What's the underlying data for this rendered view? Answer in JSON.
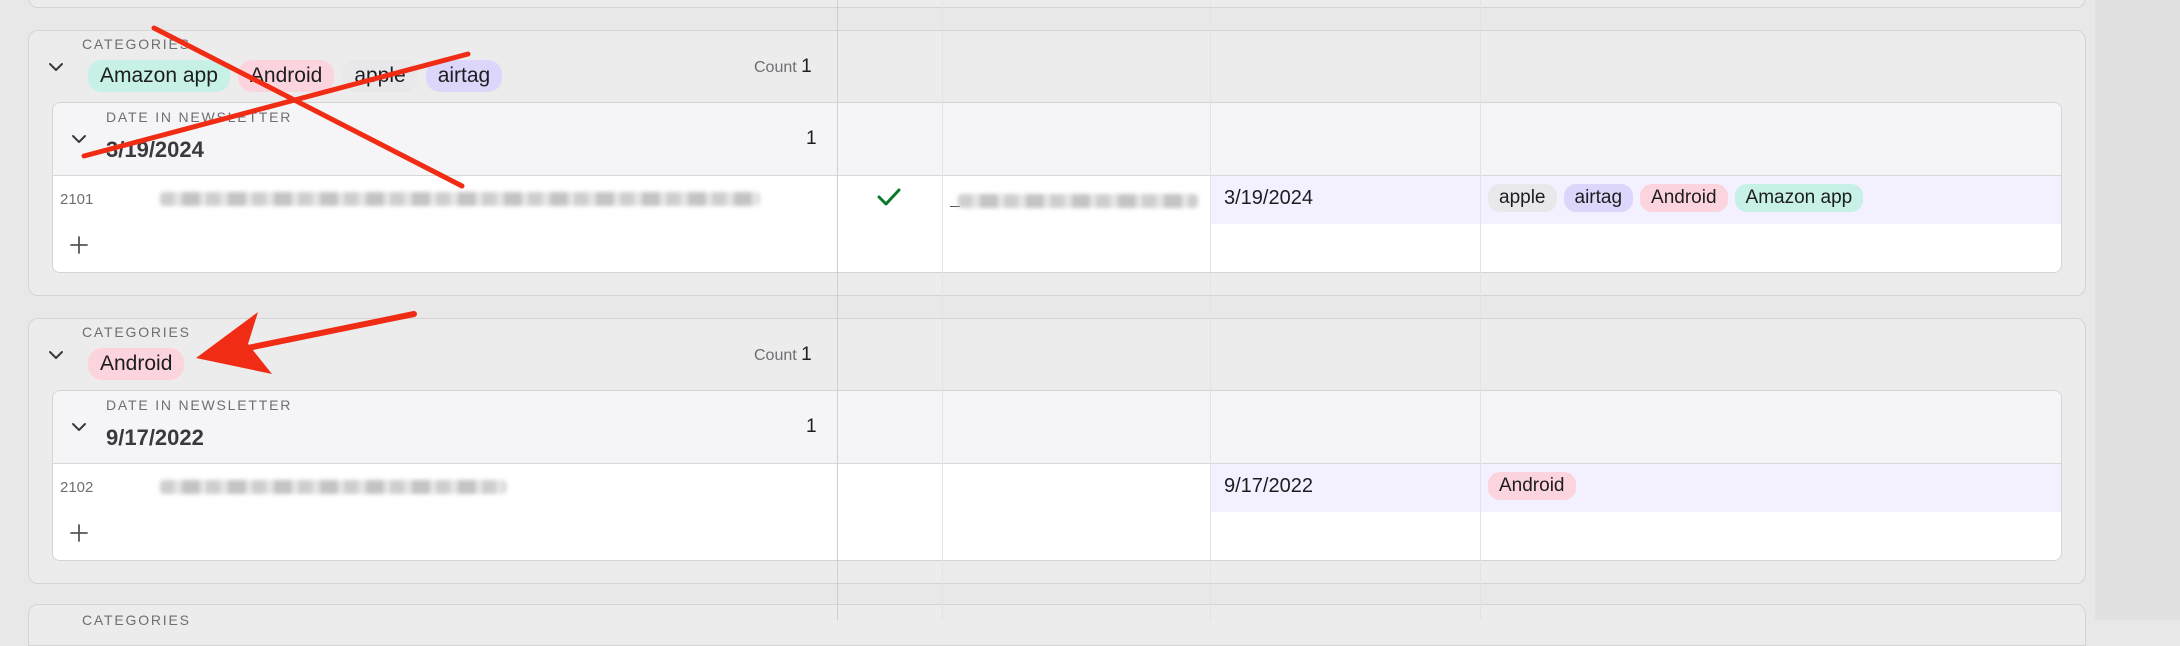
{
  "group_label": "CATEGORIES",
  "subgroup_label": "DATE IN NEWSLETTER",
  "count_label": "Count",
  "groups": [
    {
      "tags": [
        {
          "label": "Amazon app",
          "color": "#c7f0e6"
        },
        {
          "label": "Android",
          "color": "#fcd4de"
        },
        {
          "label": "apple",
          "color": "#e8e8ea"
        },
        {
          "label": "airtag",
          "color": "#ddd6fb"
        }
      ],
      "count": "1",
      "date_group": {
        "date": "3/19/2024",
        "count": "1"
      },
      "record": {
        "id": "2101",
        "checked": true,
        "date": "3/19/2024",
        "tags": [
          {
            "label": "apple",
            "color": "#e8e8ea"
          },
          {
            "label": "airtag",
            "color": "#ddd6fb"
          },
          {
            "label": "Android",
            "color": "#fcd4de"
          },
          {
            "label": "Amazon app",
            "color": "#c7f0e6"
          }
        ]
      }
    },
    {
      "tags": [
        {
          "label": "Android",
          "color": "#fcd4de"
        }
      ],
      "count": "1",
      "date_group": {
        "date": "9/17/2022",
        "count": "1"
      },
      "record": {
        "id": "2102",
        "checked": false,
        "date": "9/17/2022",
        "tags": [
          {
            "label": "Android",
            "color": "#fcd4de"
          }
        ]
      }
    }
  ],
  "annotation_color": "#f02c15"
}
